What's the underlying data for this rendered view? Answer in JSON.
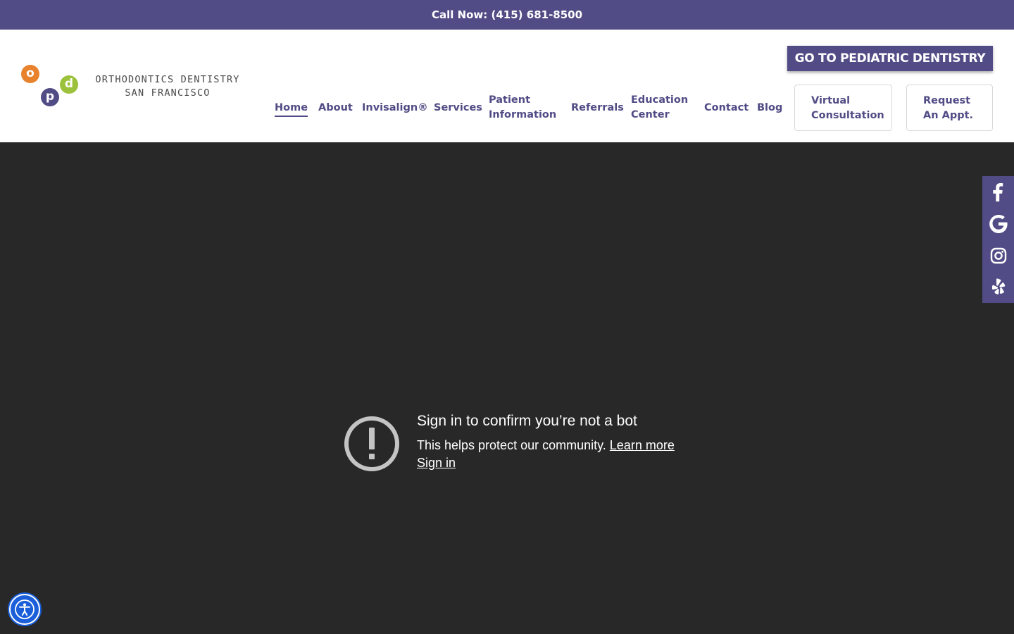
{
  "topbar": {
    "call_text": "Call Now: (415) 681-8500"
  },
  "logo": {
    "letters": {
      "o": "o",
      "p": "p",
      "d": "d"
    },
    "line1": "ORTHODONTICS DENTISTRY",
    "line2": "SAN FRANCISCO"
  },
  "cta": {
    "label": "GO TO PEDIATRIC DENTISTRY"
  },
  "nav": {
    "home": "Home",
    "about": "About",
    "invisalign": "Invisalign®",
    "services": "Services",
    "patient_1": "Patient",
    "patient_2": "Information",
    "referrals": "Referrals",
    "education_1": "Education",
    "education_2": "Center",
    "contact": "Contact",
    "blog": "Blog",
    "virtual_1": "Virtual",
    "virtual_2": "Consultation",
    "request_1": "Request",
    "request_2": "An Appt."
  },
  "video_message": {
    "title": "Sign in to confirm you’re not a bot",
    "body": "This helps protect our community.",
    "learn_more": "Learn more",
    "sign_in": "Sign in"
  },
  "social": [
    "facebook-icon",
    "google-icon",
    "instagram-icon",
    "yelp-icon"
  ],
  "colors": {
    "brand_purple": "#524c86",
    "orange": "#e8822c",
    "green": "#9cc23b",
    "video_bg": "#282828",
    "a11y_blue": "#1a5fd9"
  }
}
